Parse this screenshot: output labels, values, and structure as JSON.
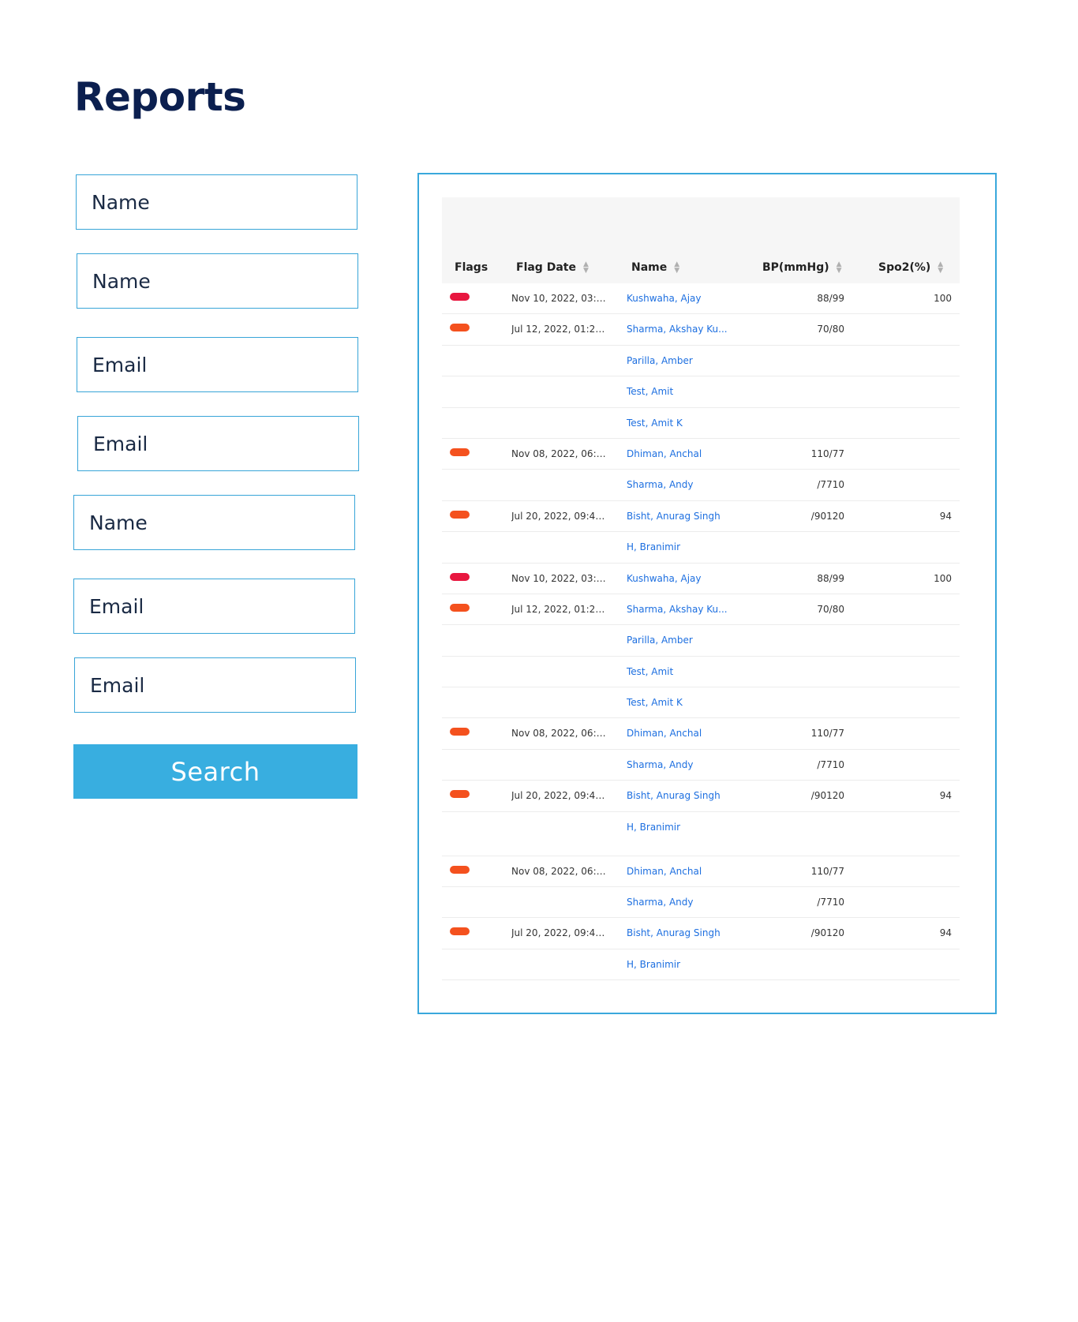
{
  "page": {
    "title": "Reports"
  },
  "form": {
    "fields": [
      {
        "placeholder": "Name"
      },
      {
        "placeholder": "Name"
      },
      {
        "placeholder": "Email"
      },
      {
        "placeholder": "Email"
      },
      {
        "placeholder": "Name"
      },
      {
        "placeholder": "Email"
      },
      {
        "placeholder": "Email"
      }
    ],
    "search_label": "Search"
  },
  "colors": {
    "accent": "#38aee0",
    "title": "#0b1f4f",
    "link": "#1d6fe0",
    "flag_red": "#e8173f",
    "flag_orange": "#f4511e"
  },
  "table": {
    "columns": [
      {
        "label": "Flags",
        "sortable": false
      },
      {
        "label": "Flag Date",
        "sortable": true
      },
      {
        "label": "Name",
        "sortable": true
      },
      {
        "label": "BP(mmHg)",
        "sortable": true
      },
      {
        "label": "Spo2(%)",
        "sortable": true
      }
    ],
    "rows": [
      {
        "flag": "red",
        "date": "Nov 10, 2022, 03:3...",
        "name": "Kushwaha, Ajay",
        "bp": "88/99",
        "spo2": "100"
      },
      {
        "flag": "orange",
        "date": "Jul 12, 2022, 01:20 ...",
        "name": "Sharma, Akshay Ku...",
        "bp": "70/80",
        "spo2": ""
      },
      {
        "flag": "",
        "date": "",
        "name": "Parilla, Amber",
        "bp": "",
        "spo2": ""
      },
      {
        "flag": "",
        "date": "",
        "name": "Test, Amit",
        "bp": "",
        "spo2": ""
      },
      {
        "flag": "",
        "date": "",
        "name": "Test, Amit K",
        "bp": "",
        "spo2": ""
      },
      {
        "flag": "orange",
        "date": "Nov 08, 2022, 06:5...",
        "name": "Dhiman, Anchal",
        "bp": "110/77",
        "spo2": ""
      },
      {
        "flag": "",
        "date": "",
        "name": "Sharma, Andy",
        "bp": "/7710",
        "spo2": ""
      },
      {
        "flag": "orange",
        "date": "Jul 20, 2022, 09:41 ...",
        "name": "Bisht, Anurag Singh",
        "bp": "/90120",
        "spo2": "94"
      },
      {
        "flag": "",
        "date": "",
        "name": "H, Branimir",
        "bp": "",
        "spo2": ""
      },
      {
        "flag": "red",
        "date": "Nov 10, 2022, 03:3...",
        "name": "Kushwaha, Ajay",
        "bp": "88/99",
        "spo2": "100"
      },
      {
        "flag": "orange",
        "date": "Jul 12, 2022, 01:20 ...",
        "name": "Sharma, Akshay Ku...",
        "bp": "70/80",
        "spo2": ""
      },
      {
        "flag": "",
        "date": "",
        "name": "Parilla, Amber",
        "bp": "",
        "spo2": ""
      },
      {
        "flag": "",
        "date": "",
        "name": "Test, Amit",
        "bp": "",
        "spo2": ""
      },
      {
        "flag": "",
        "date": "",
        "name": "Test, Amit K",
        "bp": "",
        "spo2": ""
      },
      {
        "flag": "orange",
        "date": "Nov 08, 2022, 06:5...",
        "name": "Dhiman, Anchal",
        "bp": "110/77",
        "spo2": ""
      },
      {
        "flag": "",
        "date": "",
        "name": "Sharma, Andy",
        "bp": "/7710",
        "spo2": ""
      },
      {
        "flag": "orange",
        "date": "Jul 20, 2022, 09:41 ...",
        "name": "Bisht, Anurag Singh",
        "bp": "/90120",
        "spo2": "94"
      },
      {
        "flag": "",
        "date": "",
        "name": "H, Branimir",
        "bp": "",
        "spo2": ""
      },
      {
        "flag": "orange",
        "date": "Nov 08, 2022, 06:5...",
        "name": "Dhiman, Anchal",
        "bp": "110/77",
        "spo2": ""
      },
      {
        "flag": "",
        "date": "",
        "name": "Sharma, Andy",
        "bp": "/7710",
        "spo2": ""
      },
      {
        "flag": "orange",
        "date": "Jul 20, 2022, 09:41 ...",
        "name": "Bisht, Anurag Singh",
        "bp": "/90120",
        "spo2": "94"
      },
      {
        "flag": "",
        "date": "",
        "name": "H, Branimir",
        "bp": "",
        "spo2": ""
      }
    ]
  }
}
